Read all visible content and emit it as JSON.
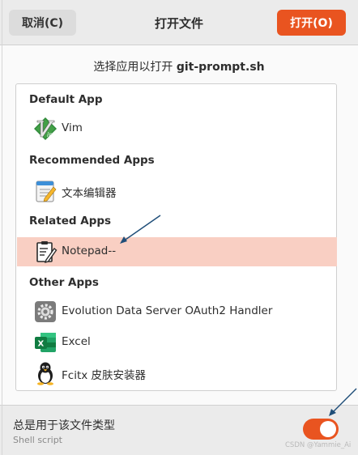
{
  "dialog": {
    "title": "打开文件",
    "cancel_label": "取消(C)",
    "open_label": "打开(O)",
    "subtitle_prefix": "选择应用以打开 ",
    "filename": "git-prompt.sh"
  },
  "sections": {
    "default": "Default App",
    "recommended": "Recommended Apps",
    "related": "Related Apps",
    "other": "Other Apps"
  },
  "apps": {
    "vim": "Vim",
    "text_editor": "文本编辑器",
    "notepad": "Notepad--",
    "evolution": "Evolution Data Server OAuth2 Handler",
    "excel": "Excel",
    "fcitx": "Fcitx 皮肤安装器"
  },
  "icons": {
    "vim": "vim-logo-icon",
    "text_editor": "text-editor-icon",
    "notepad": "notepad-icon",
    "evolution": "gear-icon",
    "excel": "excel-icon",
    "fcitx": "penguin-icon"
  },
  "footer": {
    "always_use_label": "总是用于该文件类型",
    "file_type": "Shell script",
    "toggle_on": true
  },
  "watermark": "CSDN @Yammie_Ai",
  "colors": {
    "accent": "#e95420",
    "selected_row": "#f9cfc3",
    "annotation_arrow": "#1f4e79"
  }
}
